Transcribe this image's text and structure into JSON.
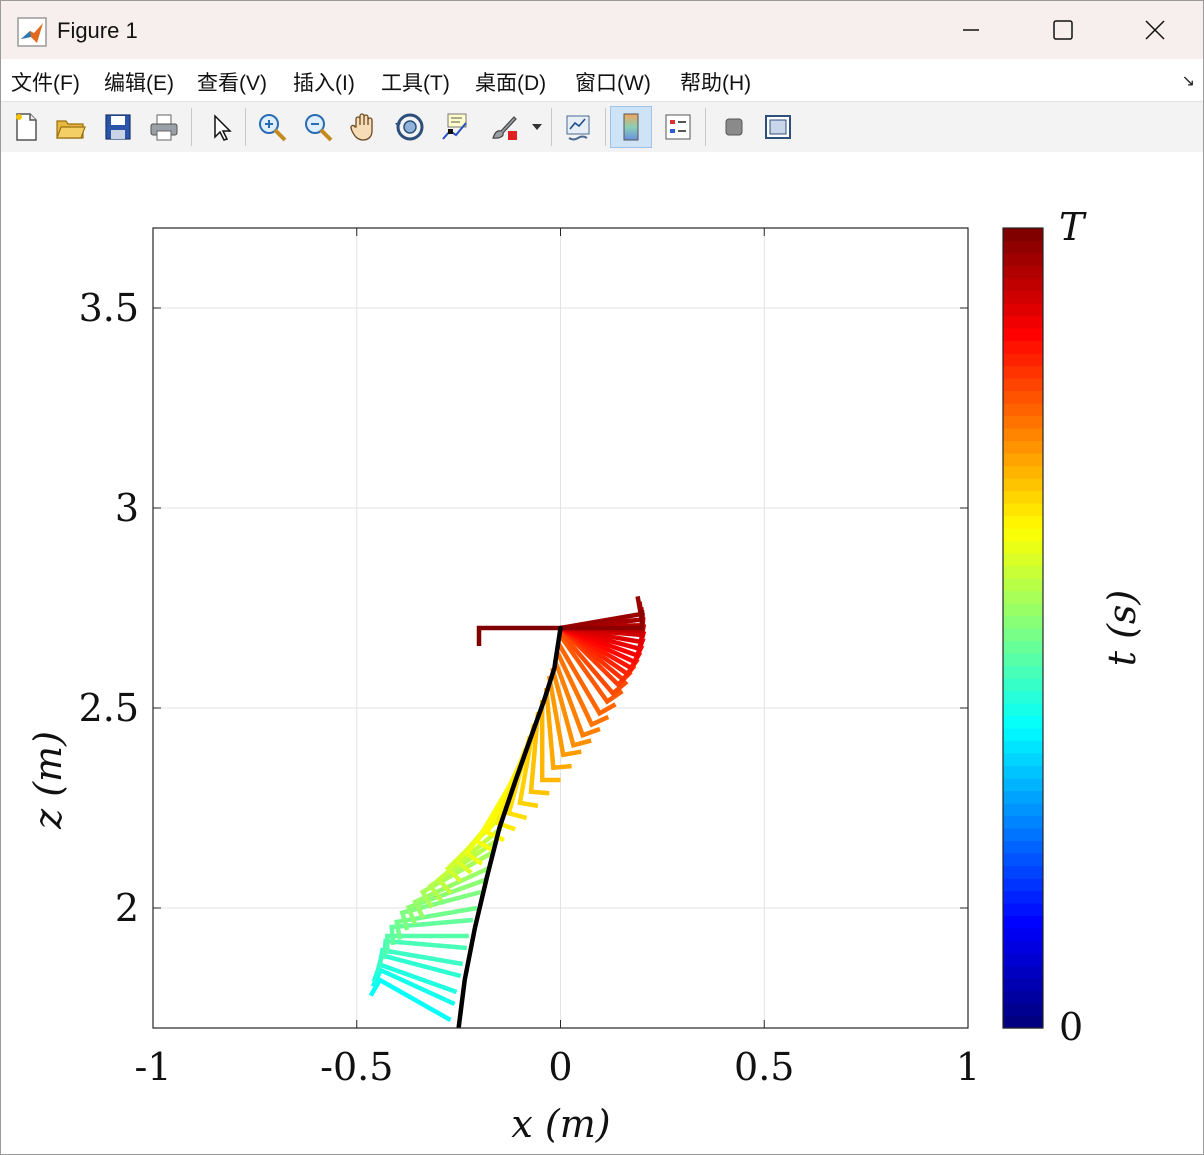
{
  "window": {
    "title": "Figure 1"
  },
  "menu": {
    "items": [
      "文件(F)",
      "编辑(E)",
      "查看(V)",
      "插入(I)",
      "工具(T)",
      "桌面(D)",
      "窗口(W)",
      "帮助(H)"
    ],
    "dock_glyph": "↘"
  },
  "toolbar": {
    "icons": [
      "new-figure-icon",
      "open-file-icon",
      "save-icon",
      "print-icon",
      "edit-plot-icon",
      "zoom-in-icon",
      "zoom-out-icon",
      "pan-icon",
      "rotate-3d-icon",
      "data-cursor-icon",
      "brush-icon",
      "link-plot-icon",
      "colorbar-icon",
      "legend-icon",
      "hide-plot-tools-icon",
      "show-plot-tools-icon"
    ],
    "active": "colorbar-icon"
  },
  "chart_data": {
    "type": "line",
    "xlabel": "x (m)",
    "ylabel": "z (m)",
    "xlim": [
      -1,
      1
    ],
    "ylim": [
      1.7,
      3.7
    ],
    "xticks": [
      -1,
      -0.5,
      0,
      0.5,
      1
    ],
    "xtick_labels": [
      "-1",
      "-0.5",
      "0",
      "0.5",
      "1"
    ],
    "yticks": [
      2,
      2.5,
      3,
      3.5
    ],
    "ytick_labels": [
      "2",
      "2.5",
      "3",
      "3.5"
    ],
    "grid": true,
    "trajectory": {
      "color": "#000000",
      "x": [
        -0.25,
        -0.235,
        -0.21,
        -0.18,
        -0.15,
        -0.11,
        -0.075,
        -0.04,
        -0.015,
        0.0
      ],
      "z": [
        1.7,
        1.82,
        1.95,
        2.08,
        2.2,
        2.32,
        2.42,
        2.52,
        2.6,
        2.7
      ]
    },
    "frames": {
      "description_source": "colored snapshots of the body, colored by time",
      "count": 48,
      "pivot_x": [
        -0.27,
        -0.26,
        -0.255,
        -0.245,
        -0.24,
        -0.23,
        -0.225,
        -0.215,
        -0.205,
        -0.195,
        -0.185,
        -0.175,
        -0.165,
        -0.155,
        -0.145,
        -0.135,
        -0.125,
        -0.115,
        -0.105,
        -0.095,
        -0.085,
        -0.075,
        -0.065,
        -0.055,
        -0.045,
        -0.035,
        -0.028,
        -0.02,
        -0.014,
        -0.008,
        -0.004,
        0.0,
        0.0,
        0.0,
        0.0,
        0.0,
        0.0,
        0.0,
        0.0,
        0.0,
        0.0,
        0.0,
        0.0,
        0.0,
        0.0,
        0.0,
        0.0,
        0.0
      ],
      "pivot_z": [
        1.72,
        1.76,
        1.79,
        1.83,
        1.86,
        1.9,
        1.93,
        1.97,
        2.0,
        2.04,
        2.07,
        2.1,
        2.14,
        2.17,
        2.2,
        2.24,
        2.27,
        2.3,
        2.34,
        2.37,
        2.4,
        2.43,
        2.46,
        2.49,
        2.52,
        2.55,
        2.58,
        2.6,
        2.62,
        2.64,
        2.66,
        2.68,
        2.69,
        2.7,
        2.7,
        2.7,
        2.7,
        2.7,
        2.7,
        2.7,
        2.7,
        2.7,
        2.7,
        2.7,
        2.7,
        2.7,
        2.7,
        2.7
      ],
      "angle_deg": [
        150,
        155,
        160,
        165,
        170,
        175,
        180,
        185,
        190,
        195,
        200,
        205,
        210,
        215,
        220,
        225,
        230,
        235,
        240,
        245,
        250,
        255,
        260,
        265,
        270,
        275,
        280,
        285,
        290,
        295,
        300,
        305,
        310,
        315,
        320,
        325,
        330,
        335,
        340,
        345,
        350,
        355,
        358,
        2,
        6,
        10,
        0,
        180
      ],
      "arm_length": 0.2,
      "hook_length": 0.045
    },
    "colorbar": {
      "colormap": "jet",
      "label": "t (s)",
      "tick_labels": [
        "0",
        "T"
      ]
    }
  }
}
